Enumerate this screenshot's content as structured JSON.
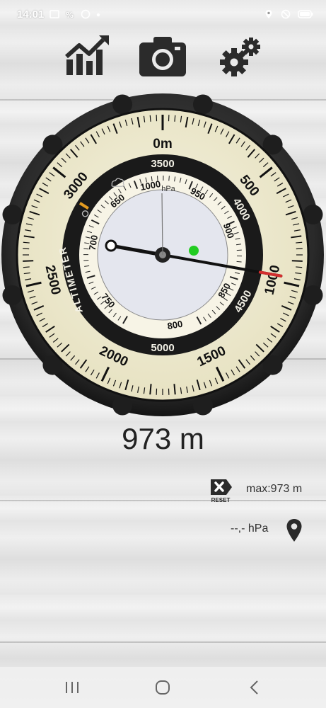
{
  "status_bar": {
    "time": "14:01",
    "left_icons": [
      "gallery-icon",
      "percent-icon",
      "whatsapp-icon",
      "dot-icon"
    ],
    "right_icons": [
      "location-icon",
      "do-not-disturb-icon",
      "battery-icon"
    ]
  },
  "toolbar": {
    "buttons": [
      "chart-icon",
      "camera-icon",
      "settings-icon"
    ]
  },
  "gauge": {
    "outer_scale": [
      "0m",
      "500",
      "1000",
      "1500",
      "2000",
      "2500",
      "3000"
    ],
    "inner_ring_scale": [
      "3500",
      "4000",
      "4500",
      "5000"
    ],
    "ring_label": "ALTIMETER",
    "pressure_scale": [
      "650",
      "700",
      "750",
      "800",
      "850",
      "900",
      "950",
      "1000"
    ],
    "pressure_unit": "hPa",
    "altitude_m": 973,
    "accent_needle": "#d32f2f",
    "indicator_color": "#22cc22",
    "weather_icons": [
      "sun-icon",
      "cloud-icon"
    ]
  },
  "readout": {
    "altitude": "973 m"
  },
  "controls": {
    "reset_label": "RESET",
    "max_text": "max:973 m",
    "pressure_text": "--,- hPa"
  },
  "navbar": {
    "buttons": [
      "recents-icon",
      "home-icon",
      "back-icon"
    ]
  }
}
